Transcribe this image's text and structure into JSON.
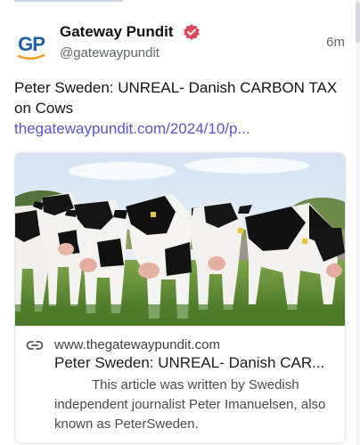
{
  "post": {
    "author": {
      "avatar_text": "GP",
      "name": "Gateway Pundit",
      "handle": "@gatewaypundit",
      "verified_icon": "verified-badge-icon"
    },
    "timestamp": "6m",
    "text": "Peter Sweden: UNREAL- Danish CARBON TAX on Cows",
    "link_text": "thegatewaypundit.com/2024/10/p..."
  },
  "card": {
    "image_alt": "Herd of black and white cows standing in a field",
    "link_icon": "link-icon",
    "domain": "www.thegatewaypundit.com",
    "title": "Peter Sweden: UNREAL- Danish CAR...",
    "description": "This article was written by Swedish independent journalist Peter Imanuelsen, also known as PeterSweden."
  },
  "colors": {
    "link": "#5b55c9",
    "verified": "#e0475a",
    "avatar_blue": "#1f5fa8",
    "avatar_orange": "#f2a024"
  }
}
